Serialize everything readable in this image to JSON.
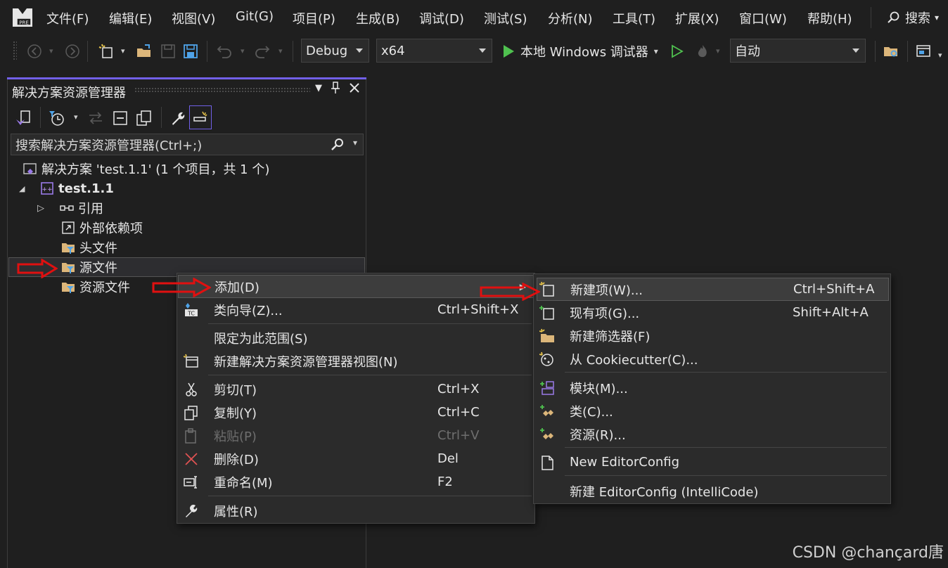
{
  "menubar": {
    "items": [
      "文件(F)",
      "编辑(E)",
      "视图(V)",
      "Git(G)",
      "项目(P)",
      "生成(B)",
      "调试(D)",
      "测试(S)",
      "分析(N)",
      "工具(T)",
      "扩展(X)",
      "窗口(W)",
      "帮助(H)"
    ],
    "search_label": "搜索"
  },
  "toolbar": {
    "config": "Debug",
    "platform": "x64",
    "run_label": "本地 Windows 调试器",
    "mode": "自动"
  },
  "panel": {
    "title": "解决方案资源管理器",
    "search_placeholder": "搜索解决方案资源管理器(Ctrl+;)",
    "tree": {
      "solution": "解决方案 'test.1.1' (1 个项目，共 1 个)",
      "project": "test.1.1",
      "references": "引用",
      "external_deps": "外部依赖项",
      "header_files": "头文件",
      "source_files": "源文件",
      "resource_files": "资源文件"
    }
  },
  "context_menu": {
    "add": "添加(D)",
    "class_wizard": "类向导(Z)...",
    "class_wizard_shortcut": "Ctrl+Shift+X",
    "scope": "限定为此范围(S)",
    "new_view": "新建解决方案资源管理器视图(N)",
    "cut": "剪切(T)",
    "cut_shortcut": "Ctrl+X",
    "copy": "复制(Y)",
    "copy_shortcut": "Ctrl+C",
    "paste": "粘贴(P)",
    "paste_shortcut": "Ctrl+V",
    "delete": "删除(D)",
    "delete_shortcut": "Del",
    "rename": "重命名(M)",
    "rename_shortcut": "F2",
    "properties": "属性(R)"
  },
  "submenu": {
    "new_item": "新建项(W)...",
    "new_item_shortcut": "Ctrl+Shift+A",
    "existing_item": "现有项(G)...",
    "existing_item_shortcut": "Shift+Alt+A",
    "new_filter": "新建筛选器(F)",
    "cookiecutter": "从 Cookiecutter(C)...",
    "module": "模块(M)...",
    "class": "类(C)...",
    "resource": "资源(R)...",
    "new_editorconfig": "New EditorConfig",
    "new_editorconfig_intellicode": "新建 EditorConfig (IntelliCode)"
  },
  "watermark": "CSDN @chançard唐",
  "colors": {
    "background": "#1f1f1f",
    "accent": "#7160e8",
    "arrow_red": "#e01010",
    "folder": "#dcb67a",
    "run_green": "#4fc14f"
  }
}
